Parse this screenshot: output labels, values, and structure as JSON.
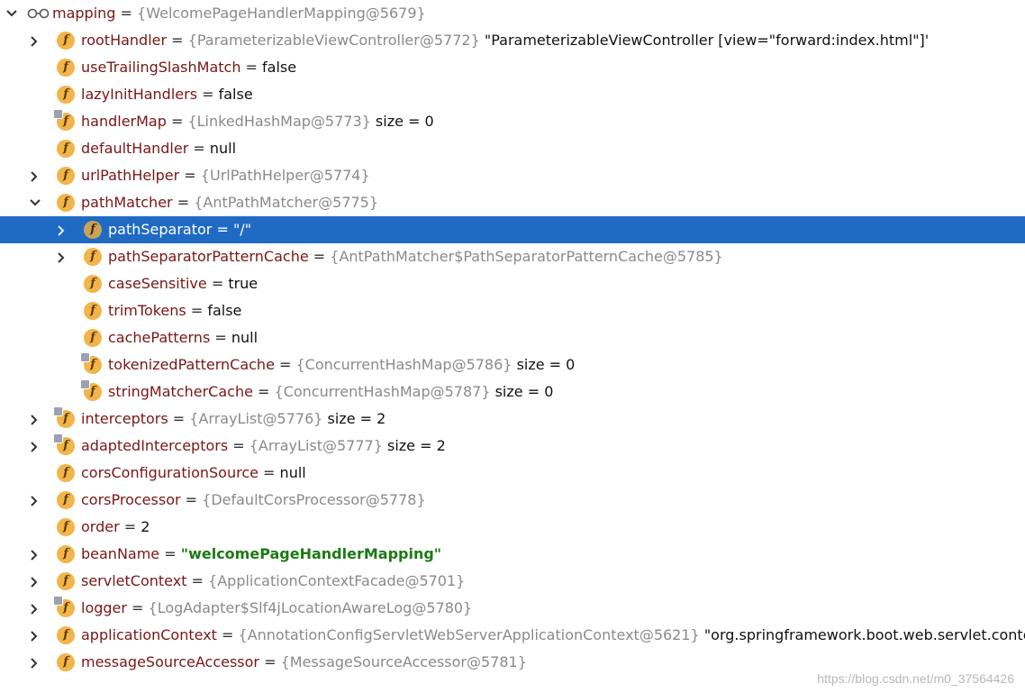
{
  "root": {
    "name": "mapping",
    "ref": "{WelcomePageHandlerMapping@5679}",
    "expanded": true
  },
  "rows": [
    {
      "name": "rootHandler",
      "ref": "{ParameterizableViewController@5772}",
      "extra": "\"ParameterizableViewController [view=\"forward:index.html\"]'",
      "toggle": "collapsed",
      "level": 1
    },
    {
      "name": "useTrailingSlashMatch",
      "plain": "false",
      "level": 1
    },
    {
      "name": "lazyInitHandlers",
      "plain": "false",
      "level": 1
    },
    {
      "name": "handlerMap",
      "ref": "{LinkedHashMap@5773}",
      "extra": "size = 0",
      "locked": true,
      "level": 1
    },
    {
      "name": "defaultHandler",
      "plain": "null",
      "level": 1
    },
    {
      "name": "urlPathHelper",
      "ref": "{UrlPathHelper@5774}",
      "toggle": "collapsed",
      "level": 1
    },
    {
      "name": "pathMatcher",
      "ref": "{AntPathMatcher@5775}",
      "toggle": "expanded",
      "level": 1
    },
    {
      "name": "pathSeparator",
      "str": "\"/\"",
      "toggle": "collapsed",
      "level": 2,
      "selected": true
    },
    {
      "name": "pathSeparatorPatternCache",
      "ref": "{AntPathMatcher$PathSeparatorPatternCache@5785}",
      "toggle": "collapsed",
      "level": 2
    },
    {
      "name": "caseSensitive",
      "plain": "true",
      "level": 2
    },
    {
      "name": "trimTokens",
      "plain": "false",
      "level": 2
    },
    {
      "name": "cachePatterns",
      "plain": "null",
      "level": 2
    },
    {
      "name": "tokenizedPatternCache",
      "ref": "{ConcurrentHashMap@5786}",
      "extra": "size = 0",
      "locked": true,
      "level": 2
    },
    {
      "name": "stringMatcherCache",
      "ref": "{ConcurrentHashMap@5787}",
      "extra": "size = 0",
      "locked": true,
      "level": 2
    },
    {
      "name": "interceptors",
      "ref": "{ArrayList@5776}",
      "extra": "size = 2",
      "locked": true,
      "toggle": "collapsed",
      "level": 1
    },
    {
      "name": "adaptedInterceptors",
      "ref": "{ArrayList@5777}",
      "extra": "size = 2",
      "locked": true,
      "toggle": "collapsed",
      "level": 1
    },
    {
      "name": "corsConfigurationSource",
      "plain": "null",
      "level": 1
    },
    {
      "name": "corsProcessor",
      "ref": "{DefaultCorsProcessor@5778}",
      "toggle": "collapsed",
      "level": 1
    },
    {
      "name": "order",
      "plain": "2",
      "level": 1
    },
    {
      "name": "beanName",
      "str": "\"welcomePageHandlerMapping\"",
      "toggle": "collapsed",
      "level": 1
    },
    {
      "name": "servletContext",
      "ref": "{ApplicationContextFacade@5701}",
      "toggle": "collapsed",
      "level": 1
    },
    {
      "name": "logger",
      "ref": "{LogAdapter$Slf4jLocationAwareLog@5780}",
      "locked": true,
      "toggle": "collapsed",
      "level": 1
    },
    {
      "name": "applicationContext",
      "ref": "{AnnotationConfigServletWebServerApplicationContext@5621}",
      "extra": "\"org.springframework.boot.web.servlet.context.A",
      "toggle": "collapsed",
      "level": 1
    },
    {
      "name": "messageSourceAccessor",
      "ref": "{MessageSourceAccessor@5781}",
      "toggle": "collapsed",
      "level": 1
    }
  ],
  "labels": {
    "eq": " = ",
    "field_icon": "f"
  },
  "watermark": "https://blog.csdn.net/m0_37564426"
}
